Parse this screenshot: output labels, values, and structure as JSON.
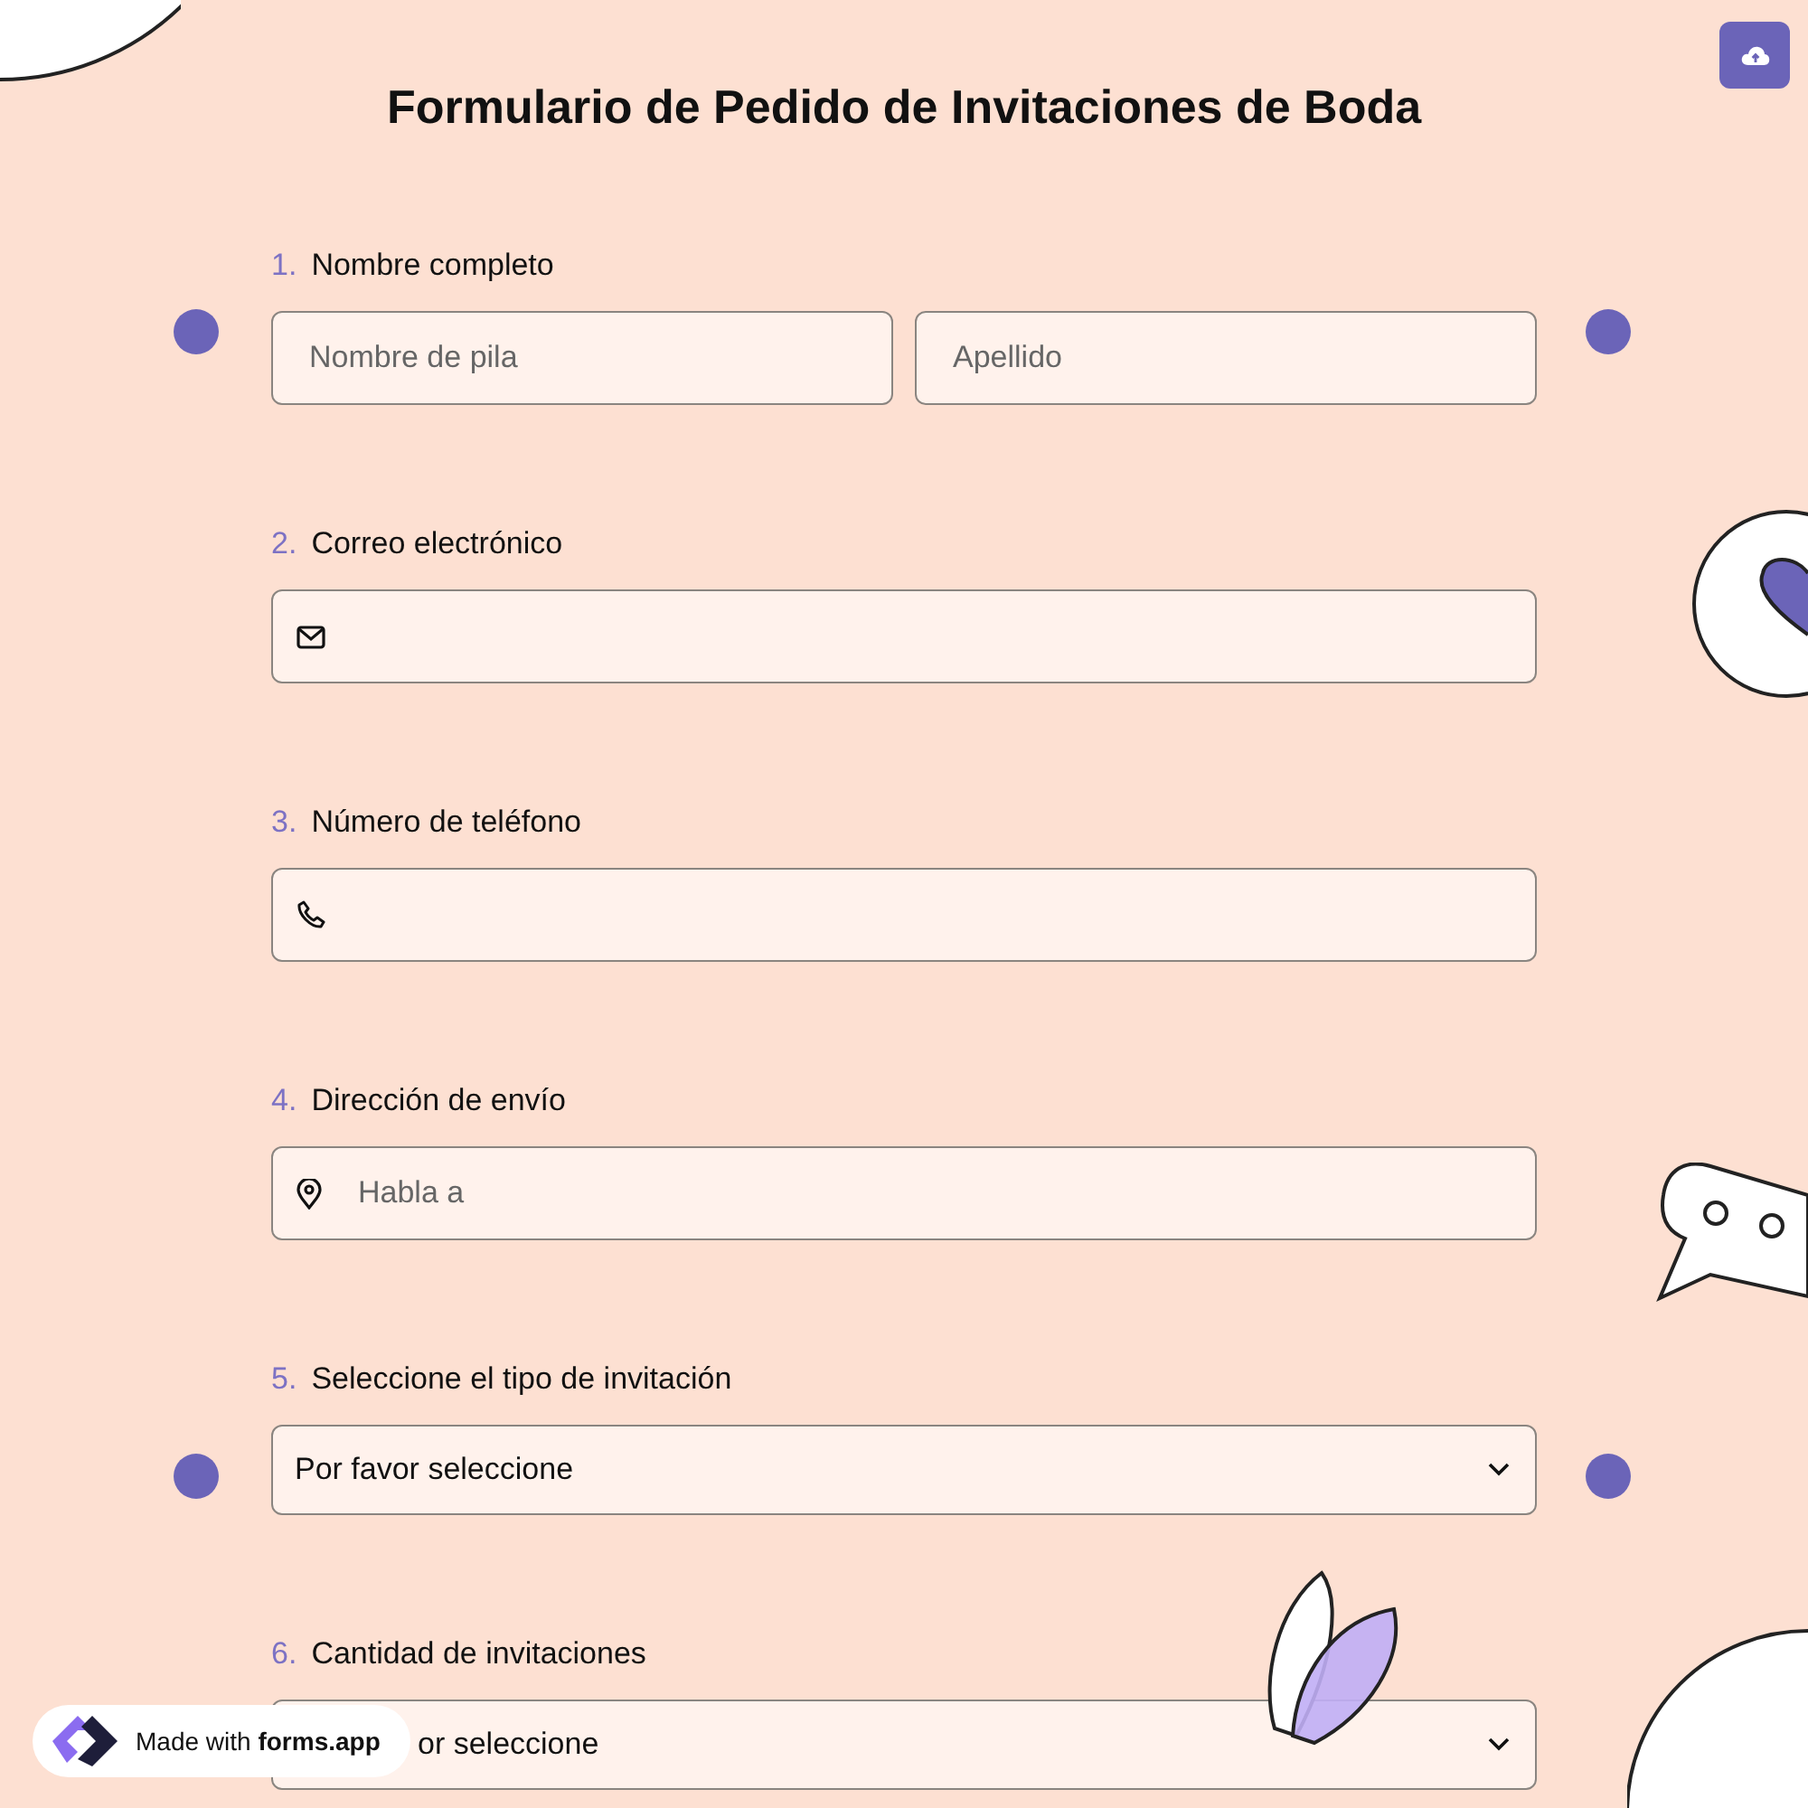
{
  "title": "Formulario de Pedido de Invitaciones de Boda",
  "questions": [
    {
      "number": "1.",
      "label": "Nombre completo",
      "kind": "name",
      "fields": [
        {
          "placeholder": "Nombre de pila"
        },
        {
          "placeholder": "Apellido"
        }
      ]
    },
    {
      "number": "2.",
      "label": "Correo electrónico",
      "kind": "email"
    },
    {
      "number": "3.",
      "label": "Número de teléfono",
      "kind": "phone"
    },
    {
      "number": "4.",
      "label": "Dirección de envío",
      "kind": "address",
      "placeholder": "Habla a"
    },
    {
      "number": "5.",
      "label": "Seleccione el tipo de invitación",
      "kind": "select",
      "value": "Por favor seleccione"
    },
    {
      "number": "6.",
      "label": "Cantidad de invitaciones",
      "kind": "select",
      "value": "or seleccione",
      "partly_hidden": true
    }
  ],
  "badge": {
    "prefix": "Made with",
    "brand": "forms.app"
  }
}
